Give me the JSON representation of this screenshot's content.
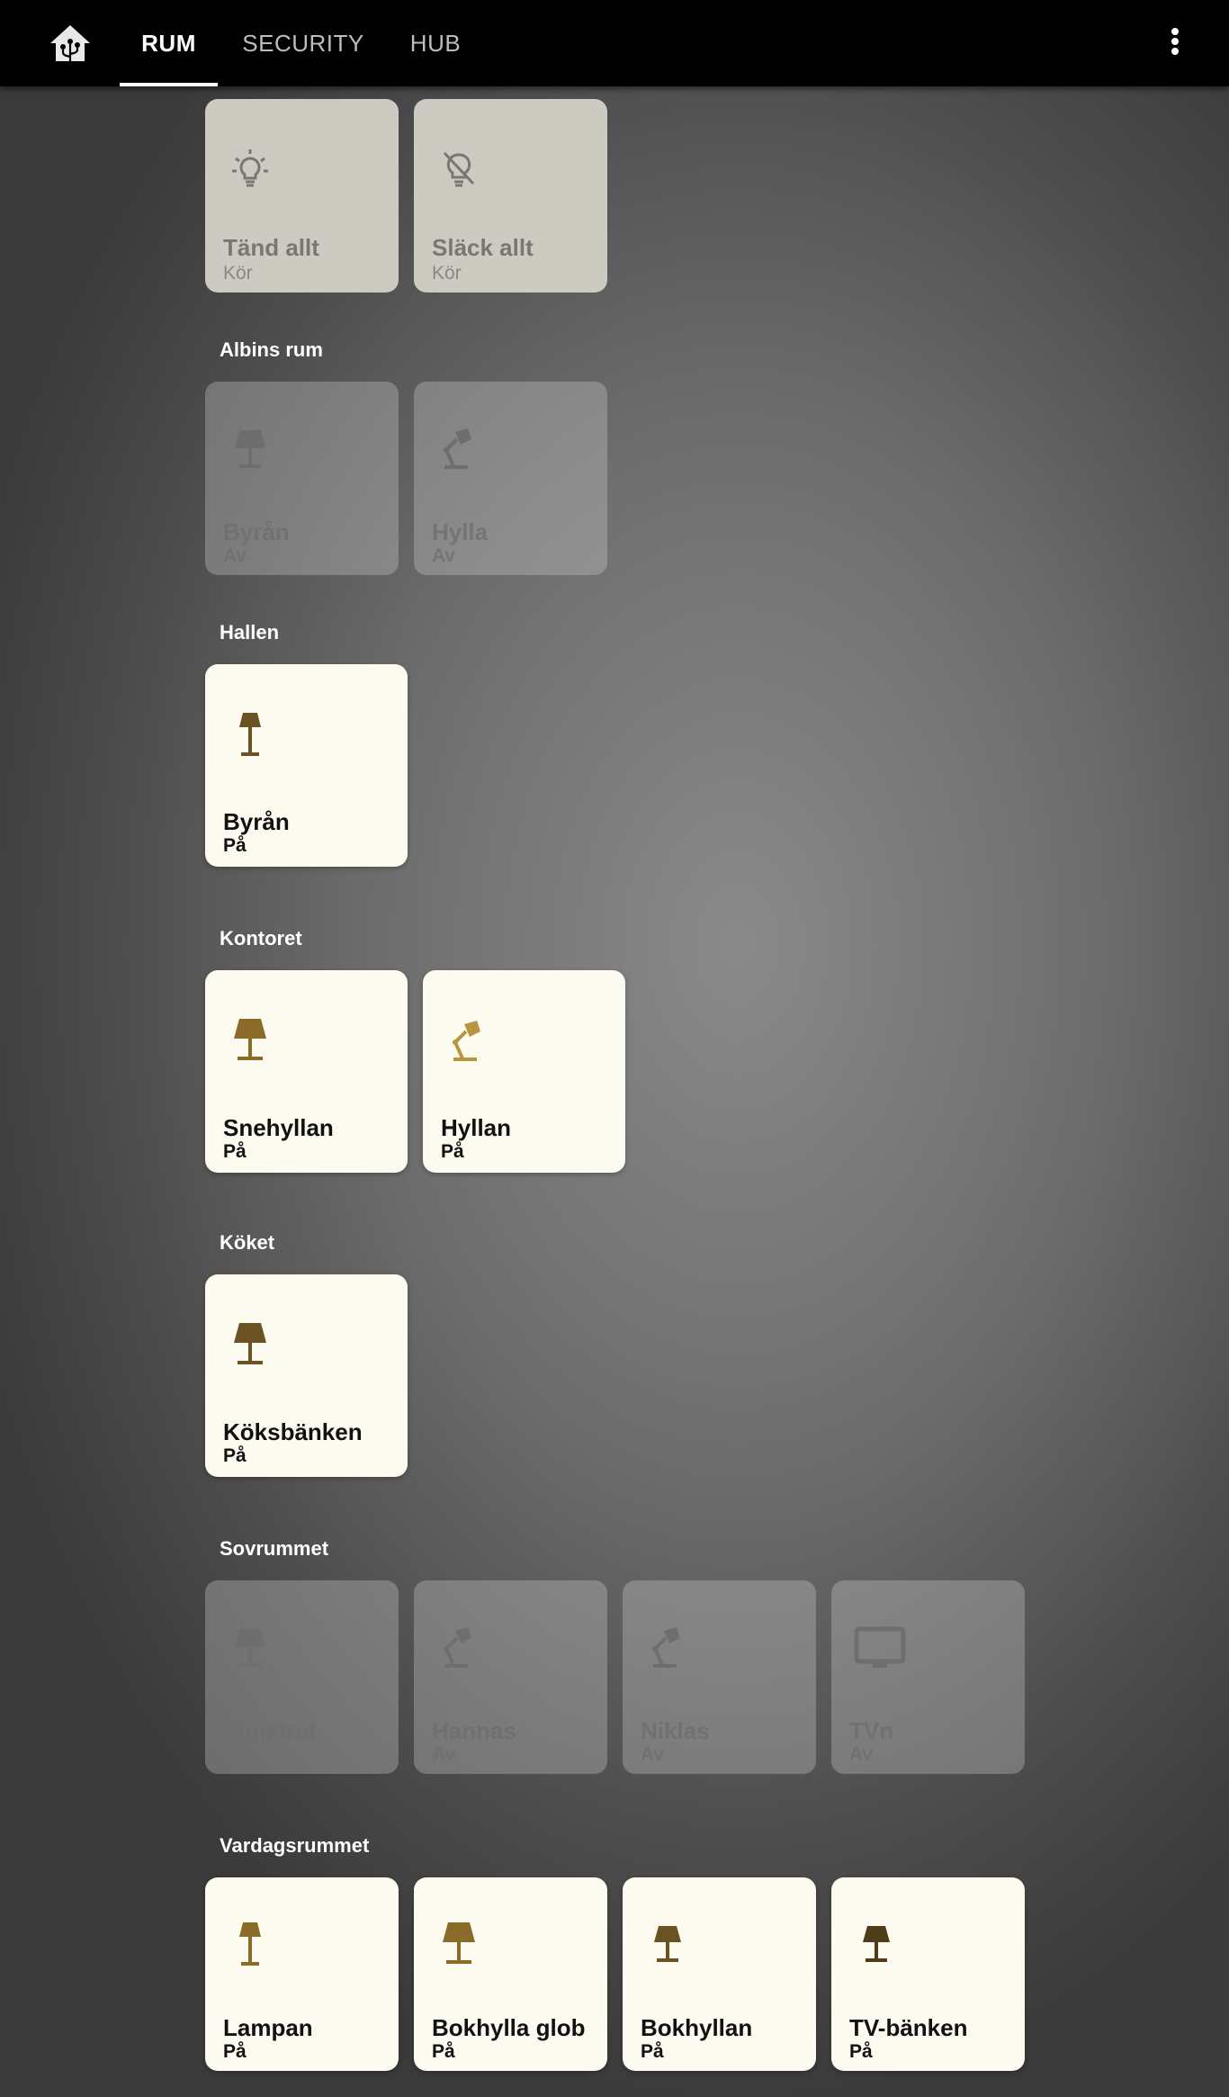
{
  "header": {
    "tabs": [
      {
        "label": "RUM",
        "active": true
      },
      {
        "label": "SECURITY",
        "active": false
      },
      {
        "label": "HUB",
        "active": false
      }
    ]
  },
  "scenes": [
    {
      "name": "Tänd allt",
      "state": "Kör",
      "icon": "lightbulb-outline-icon"
    },
    {
      "name": "Släck allt",
      "state": "Kör",
      "icon": "lightbulb-off-outline-icon"
    }
  ],
  "rooms": [
    {
      "title": "Albins rum",
      "devices": [
        {
          "name": "Byrån",
          "state": "Av",
          "icon": "lamp-icon"
        },
        {
          "name": "Hylla",
          "state": "Av",
          "icon": "desk-lamp-icon"
        }
      ]
    },
    {
      "title": "Hallen",
      "devices": [
        {
          "name": "Byrån",
          "state": "På",
          "icon": "floor-lamp-icon"
        }
      ]
    },
    {
      "title": "Kontoret",
      "devices": [
        {
          "name": "Snehyllan",
          "state": "På",
          "icon": "lamp-icon"
        },
        {
          "name": "Hyllan",
          "state": "På",
          "icon": "desk-lamp-icon"
        }
      ]
    },
    {
      "title": "Köket",
      "devices": [
        {
          "name": "Köksbänken",
          "state": "På",
          "icon": "lamp-icon"
        }
      ]
    },
    {
      "title": "Sovrummet",
      "devices": [
        {
          "name": "Fönstret",
          "state": "Av",
          "icon": "lamp-icon"
        },
        {
          "name": "Hannas",
          "state": "Av",
          "icon": "desk-lamp-icon"
        },
        {
          "name": "Niklas",
          "state": "Av",
          "icon": "desk-lamp-icon"
        },
        {
          "name": "TVn",
          "state": "Av",
          "icon": "television-icon"
        }
      ]
    },
    {
      "title": "Vardagsrummet",
      "devices": [
        {
          "name": "Lampan",
          "state": "På",
          "icon": "floor-lamp-icon"
        },
        {
          "name": "Bokhylla glob",
          "state": "På",
          "icon": "lamp-icon"
        },
        {
          "name": "Bokhyllan",
          "state": "På",
          "icon": "lamp-icon"
        },
        {
          "name": "TV-bänken",
          "state": "På",
          "icon": "lamp-icon"
        }
      ]
    }
  ],
  "colors": {
    "on_icon": "#8a6b2a",
    "on_icon_dark": "#6b5223",
    "desk_lamp_on": "#b8953f",
    "off_icon": "#6e6e6e"
  }
}
